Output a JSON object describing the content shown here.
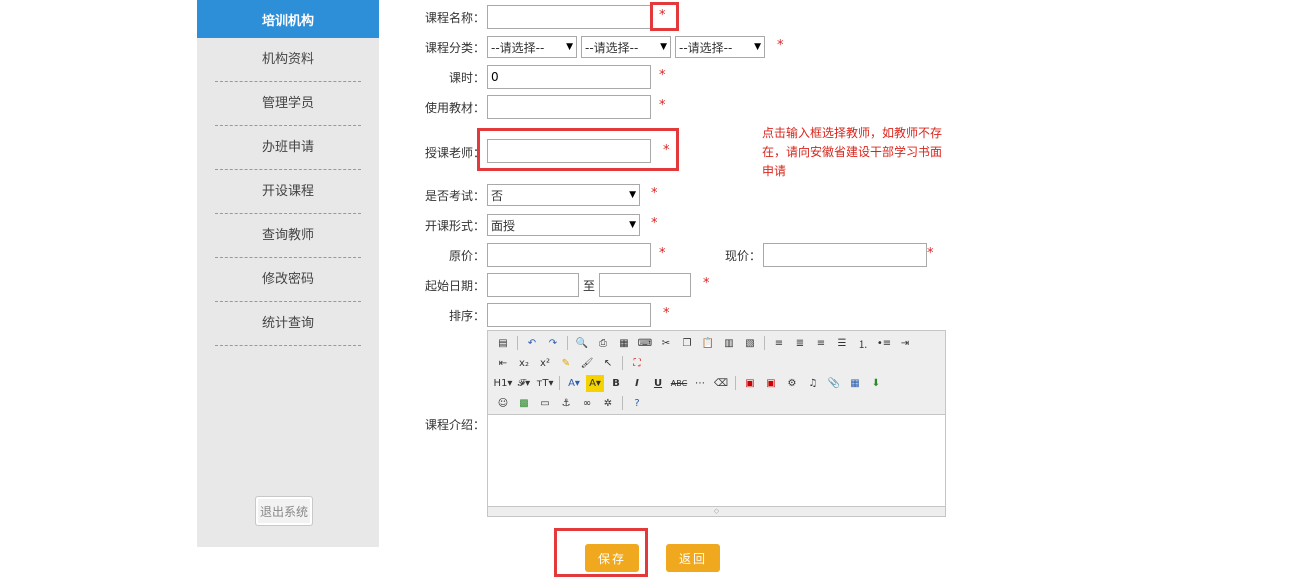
{
  "sidebar": {
    "header": "培训机构",
    "items": [
      "机构资料",
      "管理学员",
      "办班申请",
      "开设课程",
      "查询教师",
      "修改密码",
      "统计查询"
    ],
    "logout": "退出系统"
  },
  "form": {
    "course_name": {
      "label": "课程名称：",
      "value": ""
    },
    "category": {
      "label": "课程分类：",
      "options": [
        "--请选择--",
        "--请选择--",
        "--请选择--"
      ]
    },
    "hours": {
      "label": "课时：",
      "value": "0"
    },
    "textbook": {
      "label": "使用教材：",
      "value": ""
    },
    "teacher": {
      "label": "授课老师：",
      "value": ""
    },
    "teacher_hint": "点击输入框选择教师，如教师不存在，请向安徽省建设干部学习书面申请",
    "exam": {
      "label": "是否考试：",
      "value": "否"
    },
    "mode": {
      "label": "开课形式：",
      "value": "面授"
    },
    "original_price": {
      "label": "原价：",
      "value": ""
    },
    "current_price": {
      "label": "现价：",
      "value": ""
    },
    "start_date": {
      "label": "起始日期：",
      "to": "至",
      "from_value": "",
      "to_value": ""
    },
    "sort": {
      "label": "排序：",
      "value": ""
    },
    "intro": {
      "label": "课程介绍："
    },
    "required_mark": "*"
  },
  "buttons": {
    "save": "保存",
    "back": "返回"
  },
  "colors": {
    "sidebar_header": "#2e8fd9",
    "button": "#f0a81f",
    "required": "#e02020",
    "highlight_box": "#e3393a"
  }
}
